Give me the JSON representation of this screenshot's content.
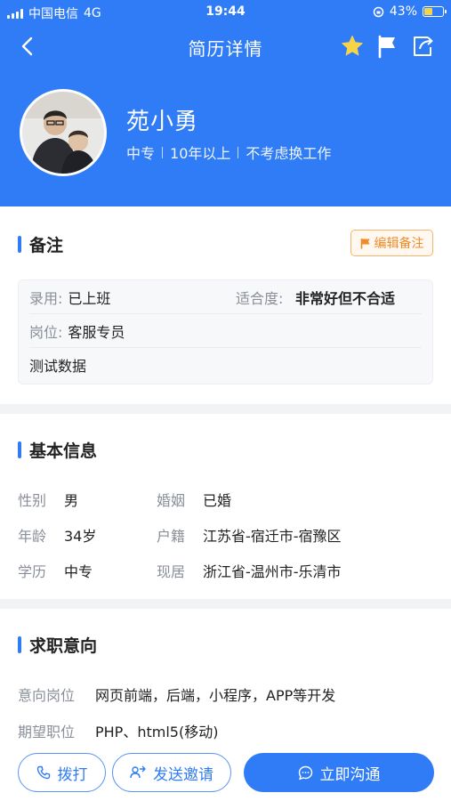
{
  "status_bar": {
    "carrier": "中国电信",
    "network": "4G",
    "time": "19:44",
    "battery": "43%",
    "battery_level": 0.43
  },
  "nav": {
    "title": "简历详情"
  },
  "profile": {
    "name": "苑小勇",
    "education": "中专",
    "experience": "10年以上",
    "job_change": "不考虑换工作"
  },
  "notes": {
    "title": "备注",
    "edit_label": "编辑备注",
    "hire_label": "录用:",
    "hire_value": "已上班",
    "fit_label": "适合度:",
    "fit_value": "非常好但不合适",
    "position_label": "岗位:",
    "position_value": "客服专员",
    "remark": "测试数据"
  },
  "basic": {
    "title": "基本信息",
    "gender_label": "性别",
    "gender": "男",
    "marriage_label": "婚姻",
    "marriage": "已婚",
    "age_label": "年龄",
    "age": "34岁",
    "hukou_label": "户籍",
    "hukou": "江苏省-宿迁市-宿豫区",
    "edu_label": "学历",
    "edu": "中专",
    "residence_label": "现居",
    "residence": "浙江省-温州市-乐清市"
  },
  "intent": {
    "title": "求职意向",
    "intended_label": "意向岗位",
    "intended_value": "网页前端，后端，小程序，APP等开发",
    "expected_label": "期望职位",
    "expected_value": "PHP、html5(移动)"
  },
  "actions": {
    "call": "拨打",
    "invite": "发送邀请",
    "chat": "立即沟通"
  },
  "colors": {
    "primary": "#2f7cf6",
    "star": "#f7d447",
    "edit": "#ef8c2a"
  },
  "icons": [
    "back-icon",
    "star-icon",
    "flag-icon",
    "share-icon",
    "phone-icon",
    "invite-icon",
    "chat-icon"
  ]
}
